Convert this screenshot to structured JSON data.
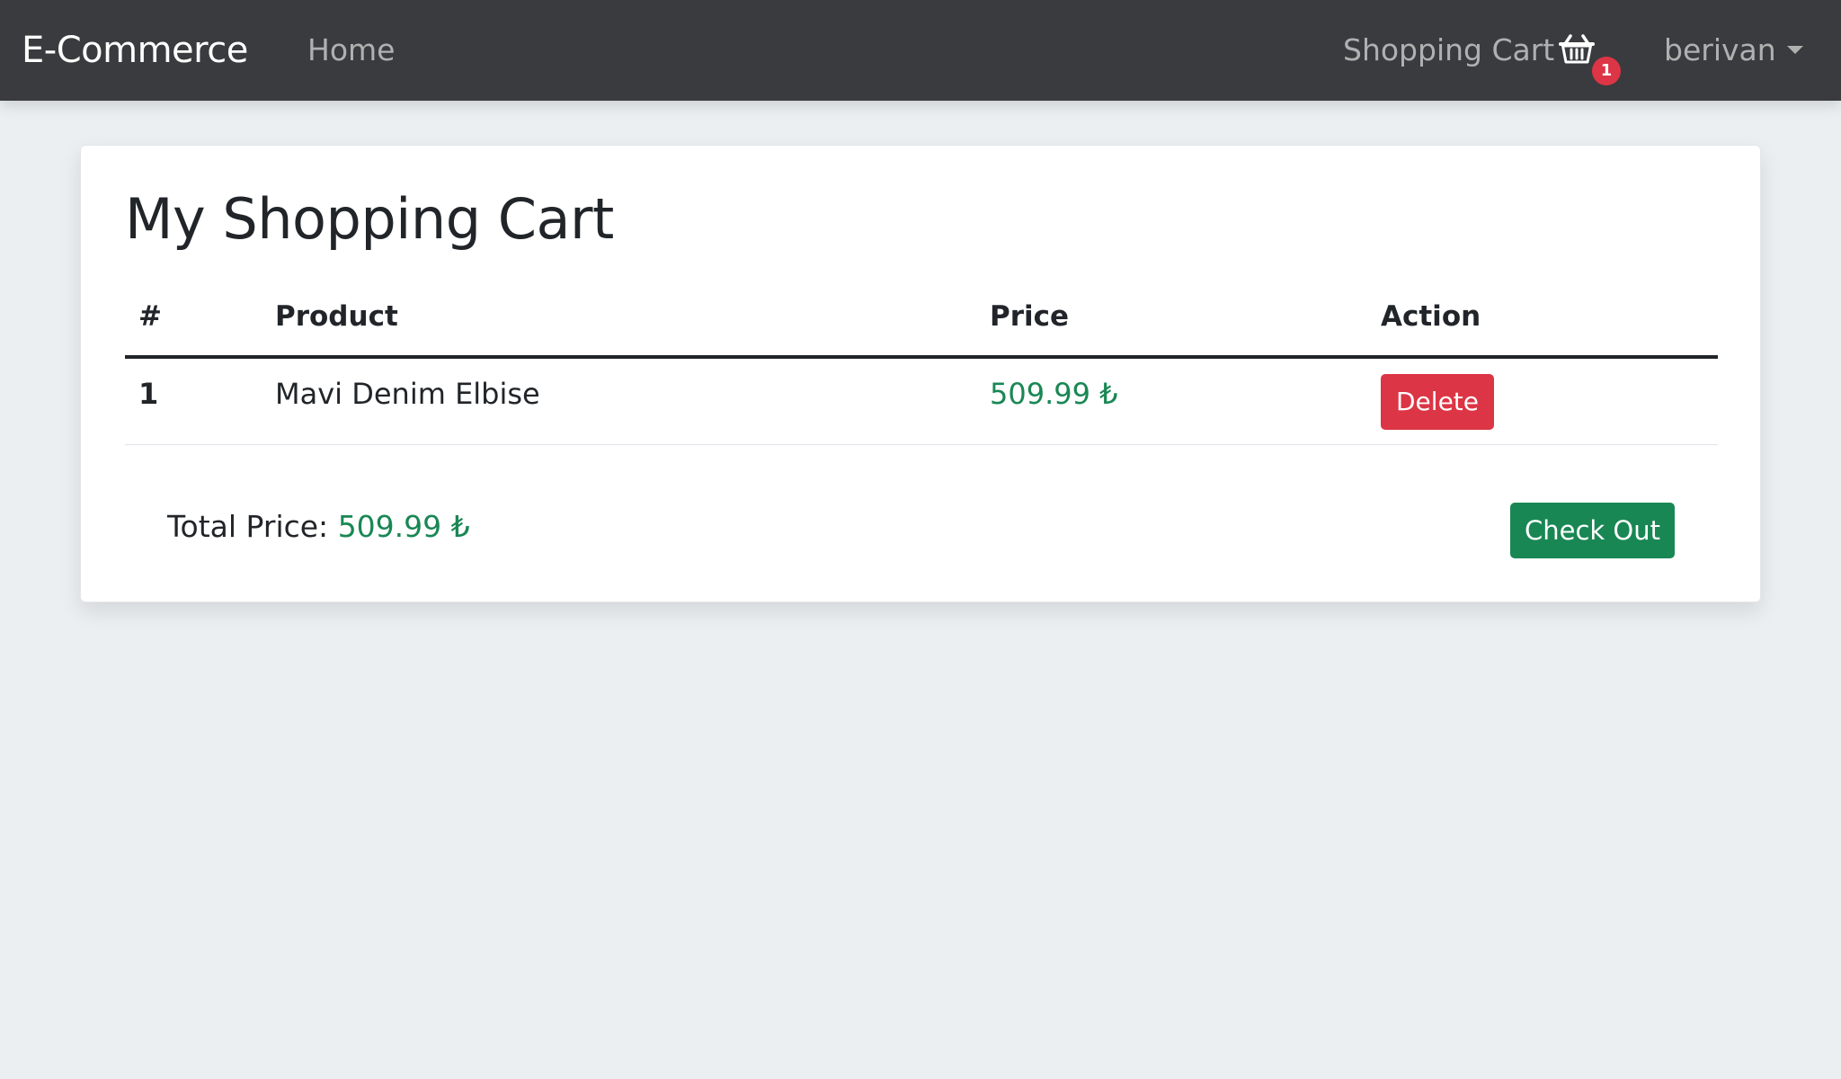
{
  "navbar": {
    "brand": "E-Commerce",
    "home": "Home",
    "cart_label": "Shopping Cart",
    "cart_icon": "basket-icon",
    "cart_count": "1",
    "user": "berivan"
  },
  "cart": {
    "title": "My Shopping Cart",
    "columns": [
      "#",
      "Product",
      "Price",
      "Action"
    ],
    "rows": [
      {
        "index": "1",
        "product": "Mavi Denim Elbise",
        "price": "509.99 ₺",
        "action": "Delete"
      }
    ],
    "total_label": "Total Price:",
    "total_value": "509.99 ₺",
    "checkout": "Check Out"
  },
  "colors": {
    "navbar": "#3a3b3e",
    "background": "#ebeff2",
    "price": "#198754",
    "danger": "#dc3545",
    "success": "#198754"
  }
}
